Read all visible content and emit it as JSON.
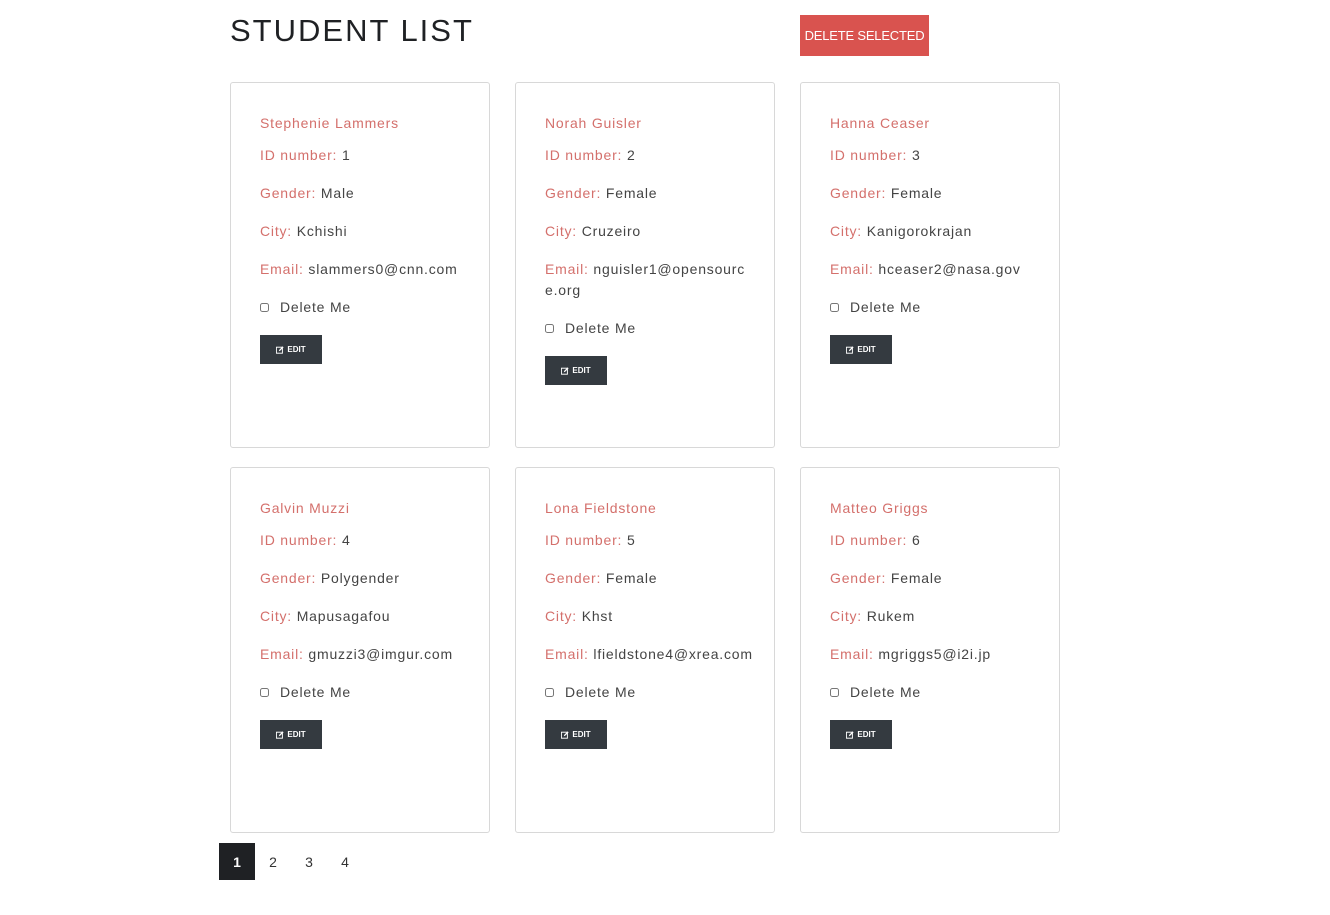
{
  "header": {
    "title": "STUDENT LIST",
    "delete_selected_label": "DELETE SELECTED"
  },
  "labels": {
    "id": "ID number:",
    "gender": "Gender:",
    "city": "City:",
    "email": "Email:",
    "delete_me": "Delete Me",
    "edit": "EDIT"
  },
  "students": [
    {
      "name": "Stephenie Lammers",
      "id": "1",
      "gender": "Male",
      "city": "Kchishi",
      "email": "slammers0@cnn.com"
    },
    {
      "name": "Norah Guisler",
      "id": "2",
      "gender": "Female",
      "city": "Cruzeiro",
      "email": "nguisler1@opensource.org"
    },
    {
      "name": "Hanna Ceaser",
      "id": "3",
      "gender": "Female",
      "city": "Kanigorokrajan",
      "email": "hceaser2@nasa.gov"
    },
    {
      "name": "Galvin Muzzi",
      "id": "4",
      "gender": "Polygender",
      "city": "Mapusagafou",
      "email": "gmuzzi3@imgur.com"
    },
    {
      "name": "Lona Fieldstone",
      "id": "5",
      "gender": "Female",
      "city": "Khst",
      "email": "lfieldstone4@xrea.com"
    },
    {
      "name": "Matteo Griggs",
      "id": "6",
      "gender": "Female",
      "city": "Rukem",
      "email": "mgriggs5@i2i.jp"
    }
  ],
  "pagination": {
    "pages": [
      "1",
      "2",
      "3",
      "4"
    ],
    "active": "1"
  },
  "colors": {
    "accent_label": "#d4706c",
    "danger_button": "#d9534f",
    "dark_button": "#343a40",
    "active_page": "#1f2124"
  },
  "icons": {
    "edit_button_icon": "edit-icon"
  }
}
